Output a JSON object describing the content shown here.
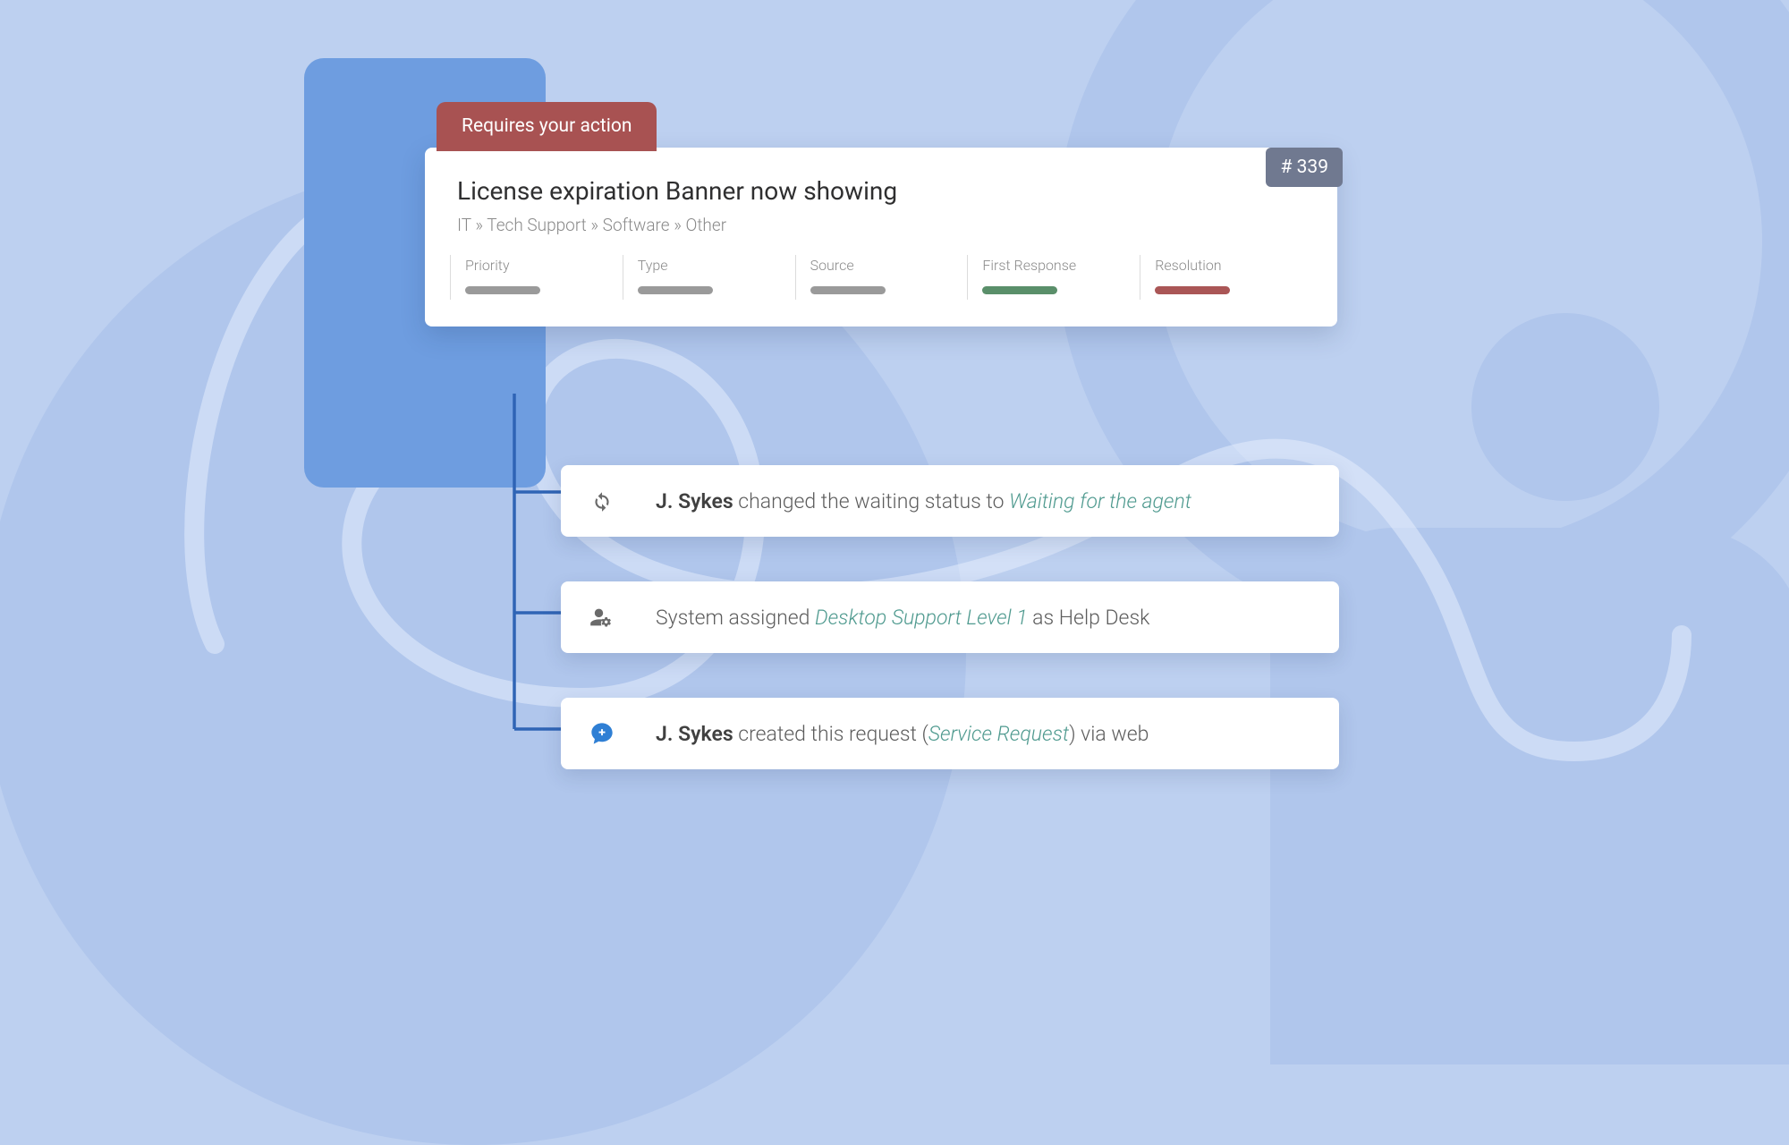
{
  "banner": {
    "label": "Requires your action"
  },
  "ticket": {
    "title": "License expiration Banner now showing",
    "breadcrumb": [
      "IT",
      "Tech Support",
      "Software",
      "Other"
    ],
    "breadcrumb_rendered": "IT » Tech Support » Software » Other",
    "id_label": "# 339",
    "id": 339
  },
  "meta": {
    "items": [
      {
        "label": "Priority",
        "bar": "gray"
      },
      {
        "label": "Type",
        "bar": "gray"
      },
      {
        "label": "Source",
        "bar": "gray"
      },
      {
        "label": "First Response",
        "bar": "green"
      },
      {
        "label": "Resolution",
        "bar": "red"
      }
    ]
  },
  "activities": [
    {
      "icon": "refresh-icon",
      "actor": "J. Sykes",
      "middle": " changed the waiting status to ",
      "emphasis": "Waiting for the agent",
      "tail": ""
    },
    {
      "icon": "users-gear-icon",
      "pre": "System assigned ",
      "emphasis": "Desktop Support Level 1",
      "tail": " as Help Desk"
    },
    {
      "icon": "comment-plus-icon",
      "actor": "J. Sykes",
      "middle": " created this request (",
      "emphasis": "Service Request",
      "tail": ") via web"
    }
  ],
  "colors": {
    "accent_blue": "#2f64b5",
    "banner_bg": "#a85252",
    "teal": "#4f9a8f"
  }
}
